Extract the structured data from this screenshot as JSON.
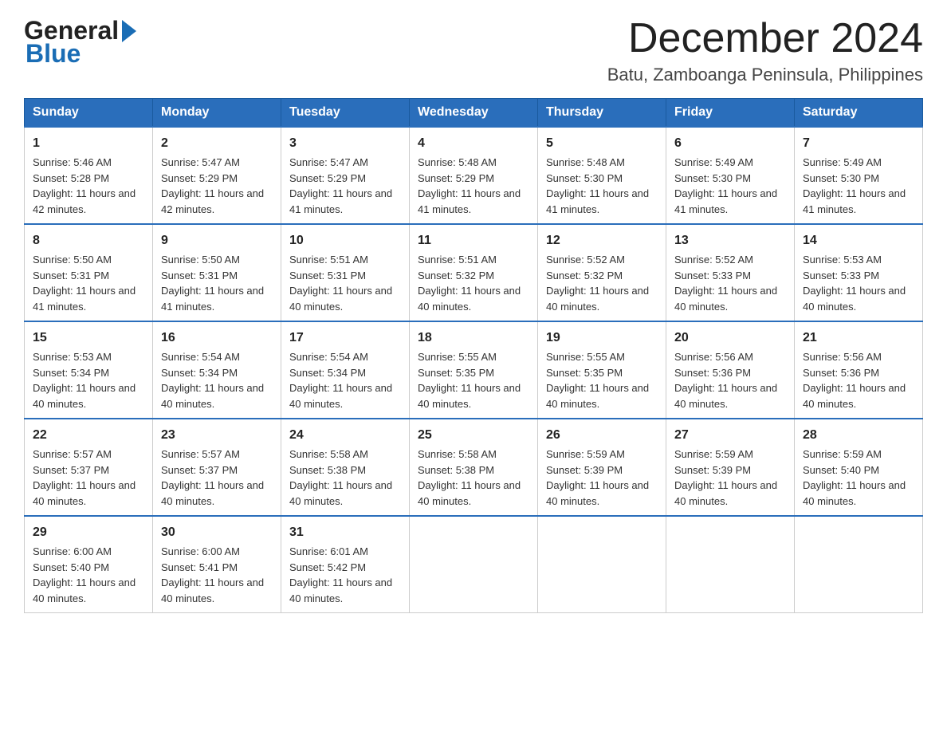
{
  "logo": {
    "general": "General",
    "blue": "Blue",
    "arrow": "▶"
  },
  "header": {
    "month_title": "December 2024",
    "location": "Batu, Zamboanga Peninsula, Philippines"
  },
  "days_of_week": [
    "Sunday",
    "Monday",
    "Tuesday",
    "Wednesday",
    "Thursday",
    "Friday",
    "Saturday"
  ],
  "weeks": [
    [
      {
        "day": "1",
        "sunrise": "Sunrise: 5:46 AM",
        "sunset": "Sunset: 5:28 PM",
        "daylight": "Daylight: 11 hours and 42 minutes."
      },
      {
        "day": "2",
        "sunrise": "Sunrise: 5:47 AM",
        "sunset": "Sunset: 5:29 PM",
        "daylight": "Daylight: 11 hours and 42 minutes."
      },
      {
        "day": "3",
        "sunrise": "Sunrise: 5:47 AM",
        "sunset": "Sunset: 5:29 PM",
        "daylight": "Daylight: 11 hours and 41 minutes."
      },
      {
        "day": "4",
        "sunrise": "Sunrise: 5:48 AM",
        "sunset": "Sunset: 5:29 PM",
        "daylight": "Daylight: 11 hours and 41 minutes."
      },
      {
        "day": "5",
        "sunrise": "Sunrise: 5:48 AM",
        "sunset": "Sunset: 5:30 PM",
        "daylight": "Daylight: 11 hours and 41 minutes."
      },
      {
        "day": "6",
        "sunrise": "Sunrise: 5:49 AM",
        "sunset": "Sunset: 5:30 PM",
        "daylight": "Daylight: 11 hours and 41 minutes."
      },
      {
        "day": "7",
        "sunrise": "Sunrise: 5:49 AM",
        "sunset": "Sunset: 5:30 PM",
        "daylight": "Daylight: 11 hours and 41 minutes."
      }
    ],
    [
      {
        "day": "8",
        "sunrise": "Sunrise: 5:50 AM",
        "sunset": "Sunset: 5:31 PM",
        "daylight": "Daylight: 11 hours and 41 minutes."
      },
      {
        "day": "9",
        "sunrise": "Sunrise: 5:50 AM",
        "sunset": "Sunset: 5:31 PM",
        "daylight": "Daylight: 11 hours and 41 minutes."
      },
      {
        "day": "10",
        "sunrise": "Sunrise: 5:51 AM",
        "sunset": "Sunset: 5:31 PM",
        "daylight": "Daylight: 11 hours and 40 minutes."
      },
      {
        "day": "11",
        "sunrise": "Sunrise: 5:51 AM",
        "sunset": "Sunset: 5:32 PM",
        "daylight": "Daylight: 11 hours and 40 minutes."
      },
      {
        "day": "12",
        "sunrise": "Sunrise: 5:52 AM",
        "sunset": "Sunset: 5:32 PM",
        "daylight": "Daylight: 11 hours and 40 minutes."
      },
      {
        "day": "13",
        "sunrise": "Sunrise: 5:52 AM",
        "sunset": "Sunset: 5:33 PM",
        "daylight": "Daylight: 11 hours and 40 minutes."
      },
      {
        "day": "14",
        "sunrise": "Sunrise: 5:53 AM",
        "sunset": "Sunset: 5:33 PM",
        "daylight": "Daylight: 11 hours and 40 minutes."
      }
    ],
    [
      {
        "day": "15",
        "sunrise": "Sunrise: 5:53 AM",
        "sunset": "Sunset: 5:34 PM",
        "daylight": "Daylight: 11 hours and 40 minutes."
      },
      {
        "day": "16",
        "sunrise": "Sunrise: 5:54 AM",
        "sunset": "Sunset: 5:34 PM",
        "daylight": "Daylight: 11 hours and 40 minutes."
      },
      {
        "day": "17",
        "sunrise": "Sunrise: 5:54 AM",
        "sunset": "Sunset: 5:34 PM",
        "daylight": "Daylight: 11 hours and 40 minutes."
      },
      {
        "day": "18",
        "sunrise": "Sunrise: 5:55 AM",
        "sunset": "Sunset: 5:35 PM",
        "daylight": "Daylight: 11 hours and 40 minutes."
      },
      {
        "day": "19",
        "sunrise": "Sunrise: 5:55 AM",
        "sunset": "Sunset: 5:35 PM",
        "daylight": "Daylight: 11 hours and 40 minutes."
      },
      {
        "day": "20",
        "sunrise": "Sunrise: 5:56 AM",
        "sunset": "Sunset: 5:36 PM",
        "daylight": "Daylight: 11 hours and 40 minutes."
      },
      {
        "day": "21",
        "sunrise": "Sunrise: 5:56 AM",
        "sunset": "Sunset: 5:36 PM",
        "daylight": "Daylight: 11 hours and 40 minutes."
      }
    ],
    [
      {
        "day": "22",
        "sunrise": "Sunrise: 5:57 AM",
        "sunset": "Sunset: 5:37 PM",
        "daylight": "Daylight: 11 hours and 40 minutes."
      },
      {
        "day": "23",
        "sunrise": "Sunrise: 5:57 AM",
        "sunset": "Sunset: 5:37 PM",
        "daylight": "Daylight: 11 hours and 40 minutes."
      },
      {
        "day": "24",
        "sunrise": "Sunrise: 5:58 AM",
        "sunset": "Sunset: 5:38 PM",
        "daylight": "Daylight: 11 hours and 40 minutes."
      },
      {
        "day": "25",
        "sunrise": "Sunrise: 5:58 AM",
        "sunset": "Sunset: 5:38 PM",
        "daylight": "Daylight: 11 hours and 40 minutes."
      },
      {
        "day": "26",
        "sunrise": "Sunrise: 5:59 AM",
        "sunset": "Sunset: 5:39 PM",
        "daylight": "Daylight: 11 hours and 40 minutes."
      },
      {
        "day": "27",
        "sunrise": "Sunrise: 5:59 AM",
        "sunset": "Sunset: 5:39 PM",
        "daylight": "Daylight: 11 hours and 40 minutes."
      },
      {
        "day": "28",
        "sunrise": "Sunrise: 5:59 AM",
        "sunset": "Sunset: 5:40 PM",
        "daylight": "Daylight: 11 hours and 40 minutes."
      }
    ],
    [
      {
        "day": "29",
        "sunrise": "Sunrise: 6:00 AM",
        "sunset": "Sunset: 5:40 PM",
        "daylight": "Daylight: 11 hours and 40 minutes."
      },
      {
        "day": "30",
        "sunrise": "Sunrise: 6:00 AM",
        "sunset": "Sunset: 5:41 PM",
        "daylight": "Daylight: 11 hours and 40 minutes."
      },
      {
        "day": "31",
        "sunrise": "Sunrise: 6:01 AM",
        "sunset": "Sunset: 5:42 PM",
        "daylight": "Daylight: 11 hours and 40 minutes."
      },
      null,
      null,
      null,
      null
    ]
  ]
}
